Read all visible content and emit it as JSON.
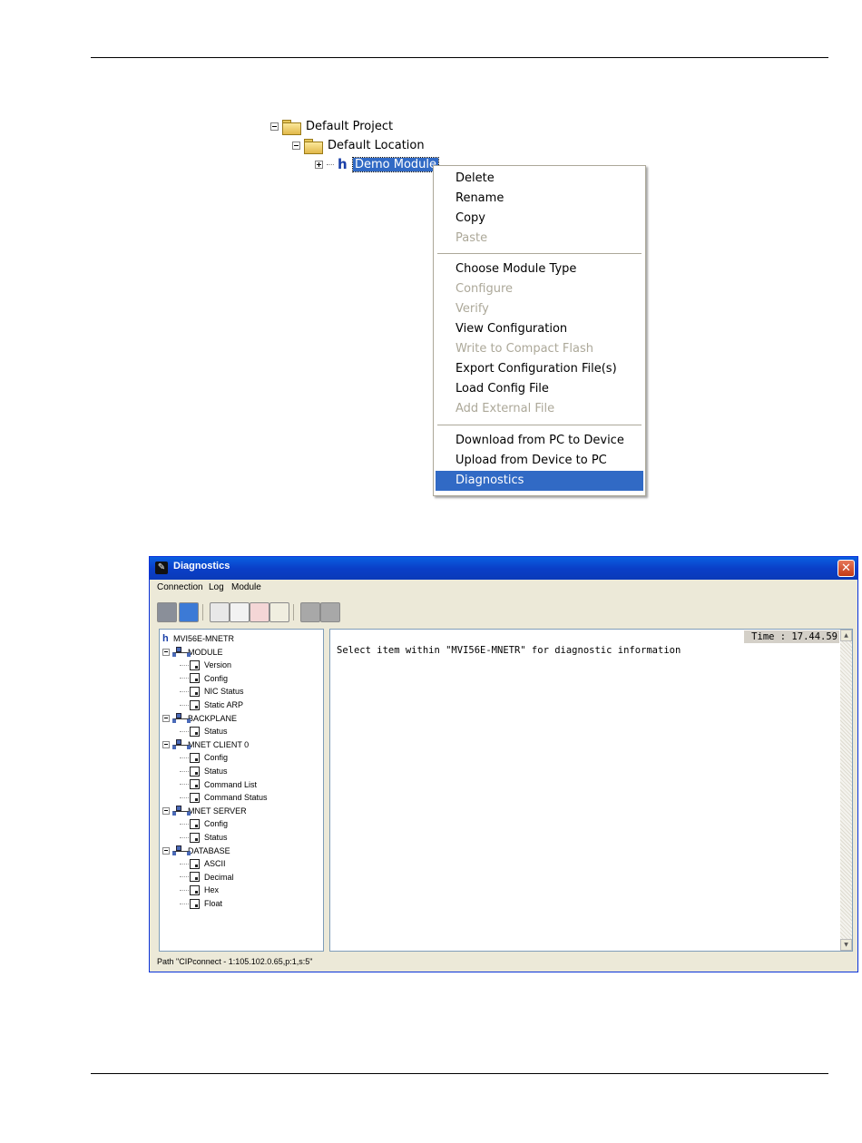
{
  "project_tree": {
    "project": "Default Project",
    "location": "Default Location",
    "module": "Demo Module"
  },
  "context_menu": {
    "items": [
      {
        "label": "Delete",
        "enabled": true
      },
      {
        "label": "Rename",
        "enabled": true
      },
      {
        "label": "Copy",
        "enabled": true
      },
      {
        "label": "Paste",
        "enabled": false
      },
      {
        "label": "Choose Module Type",
        "enabled": true
      },
      {
        "label": "Configure",
        "enabled": false
      },
      {
        "label": "Verify",
        "enabled": false
      },
      {
        "label": "View Configuration",
        "enabled": true
      },
      {
        "label": "Write to Compact Flash",
        "enabled": false
      },
      {
        "label": "Export Configuration File(s)",
        "enabled": true
      },
      {
        "label": "Load Config File",
        "enabled": true
      },
      {
        "label": "Add External File",
        "enabled": false
      },
      {
        "label": "Download from PC to Device",
        "enabled": true
      },
      {
        "label": "Upload from Device to PC",
        "enabled": true
      },
      {
        "label": "Diagnostics",
        "enabled": true,
        "selected": true
      }
    ]
  },
  "diagnostics": {
    "title": "Diagnostics",
    "menu": [
      "Connection",
      "Log",
      "Module"
    ],
    "toolbar_icons": [
      "connect-icon",
      "disconnect-icon",
      "find-icon",
      "capture-icon",
      "send-icon",
      "mail-icon",
      "module-icon",
      "tool-icon"
    ],
    "tree": {
      "root": "MVI56E-MNETR",
      "groups": [
        {
          "label": "MODULE",
          "children": [
            "Version",
            "Config",
            "NIC Status",
            "Static ARP"
          ]
        },
        {
          "label": "BACKPLANE",
          "children": [
            "Status"
          ]
        },
        {
          "label": "MNET CLIENT 0",
          "children": [
            "Config",
            "Status",
            "Command List",
            "Command Status"
          ]
        },
        {
          "label": "MNET SERVER",
          "children": [
            "Config",
            "Status"
          ]
        },
        {
          "label": "DATABASE",
          "children": [
            "ASCII",
            "Decimal",
            "Hex",
            "Float"
          ]
        }
      ]
    },
    "time_label": "Time : 17.44.59",
    "output_message": "Select item within \"MVI56E-MNETR\" for diagnostic information",
    "status_path": "Path \"CIPconnect - 1:105.102.0.65,p:1,s:5\""
  },
  "colors": {
    "selection": "#316ac5",
    "titlebar": "#0a4fd8",
    "disabled_text": "#aca899"
  }
}
